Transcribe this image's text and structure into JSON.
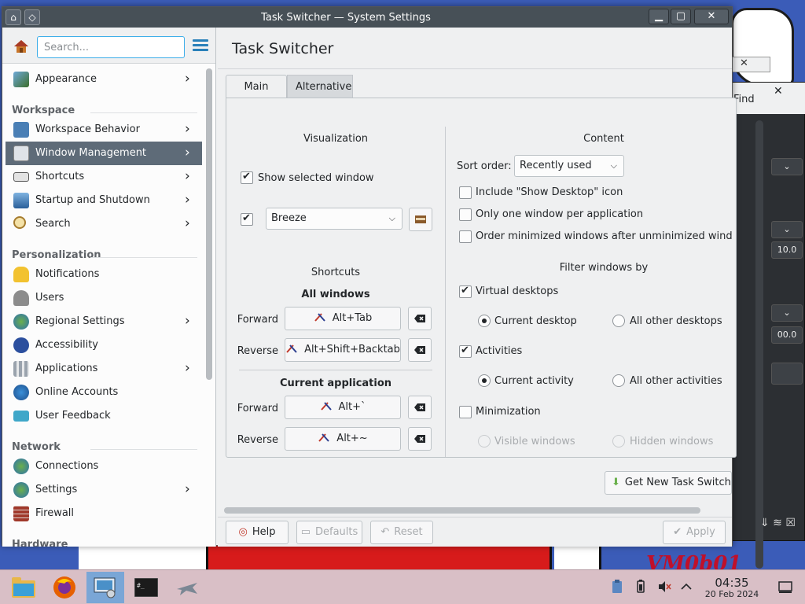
{
  "window": {
    "title": "Task Switcher — System Settings"
  },
  "search": {
    "placeholder": "Search..."
  },
  "sidebar": {
    "top_items": [
      {
        "label": "Appearance",
        "icon": "appearance-icon"
      }
    ],
    "categories": [
      {
        "label": "Workspace",
        "items": [
          {
            "label": "Workspace Behavior",
            "icon": "workspace-behavior-icon"
          },
          {
            "label": "Window Management",
            "icon": "window-management-icon",
            "active": true
          },
          {
            "label": "Shortcuts",
            "icon": "keyboard-icon"
          },
          {
            "label": "Startup and Shutdown",
            "icon": "startup-icon"
          },
          {
            "label": "Search",
            "icon": "search-icon"
          }
        ]
      },
      {
        "label": "Personalization",
        "items": [
          {
            "label": "Notifications",
            "icon": "bell-icon"
          },
          {
            "label": "Users",
            "icon": "users-icon"
          },
          {
            "label": "Regional Settings",
            "icon": "globe-icon"
          },
          {
            "label": "Accessibility",
            "icon": "accessibility-icon"
          },
          {
            "label": "Applications",
            "icon": "applications-icon"
          },
          {
            "label": "Online Accounts",
            "icon": "online-accounts-icon"
          },
          {
            "label": "User Feedback",
            "icon": "feedback-icon"
          }
        ]
      },
      {
        "label": "Network",
        "items": [
          {
            "label": "Connections",
            "icon": "connections-icon"
          },
          {
            "label": "Settings",
            "icon": "network-settings-icon"
          },
          {
            "label": "Firewall",
            "icon": "firewall-icon"
          }
        ]
      },
      {
        "label": "Hardware",
        "items": []
      }
    ]
  },
  "page": {
    "title": "Task Switcher",
    "tabs": [
      {
        "label": "Main"
      },
      {
        "label": "Alternative"
      }
    ]
  },
  "visualization": {
    "title": "Visualization",
    "show_selected_window": "Show selected window",
    "style_value": "Breeze"
  },
  "shortcuts": {
    "title": "Shortcuts",
    "all_windows": "All windows",
    "current_application": "Current application",
    "forward_label": "Forward",
    "reverse_label": "Reverse",
    "all_forward": "Alt+Tab",
    "all_reverse": "Alt+Shift+Backtab",
    "app_forward": "Alt+`",
    "app_reverse": "Alt+~"
  },
  "content": {
    "title": "Content",
    "sort_order_label": "Sort order:",
    "sort_order_value": "Recently used",
    "include_show_desktop": "Include \"Show Desktop\" icon",
    "one_window_per_app": "Only one window per application",
    "order_minimized": "Order minimized windows after unminimized windows"
  },
  "filter": {
    "title": "Filter windows by",
    "virtual_desktops": "Virtual desktops",
    "current_desktop": "Current desktop",
    "all_other_desktops": "All other desktops",
    "activities": "Activities",
    "current_activity": "Current activity",
    "all_other_activities": "All other activities",
    "minimization": "Minimization",
    "visible_windows": "Visible windows",
    "hidden_windows": "Hidden windows"
  },
  "footer": {
    "get_new": "Get New Task Switchers...",
    "help": "Help",
    "defaults": "Defaults",
    "reset": "Reset",
    "apply": "Apply"
  },
  "side_window": {
    "find": "Find",
    "value1": "10.0",
    "value2": "00.0"
  },
  "taskbar": {
    "time": "04:35",
    "date": "20 Feb 2024",
    "apps": [
      "file-manager-icon",
      "firefox-icon",
      "system-settings-icon",
      "terminal-icon",
      "jet-icon"
    ]
  },
  "desktop": {
    "watermark": "VM0b01"
  }
}
